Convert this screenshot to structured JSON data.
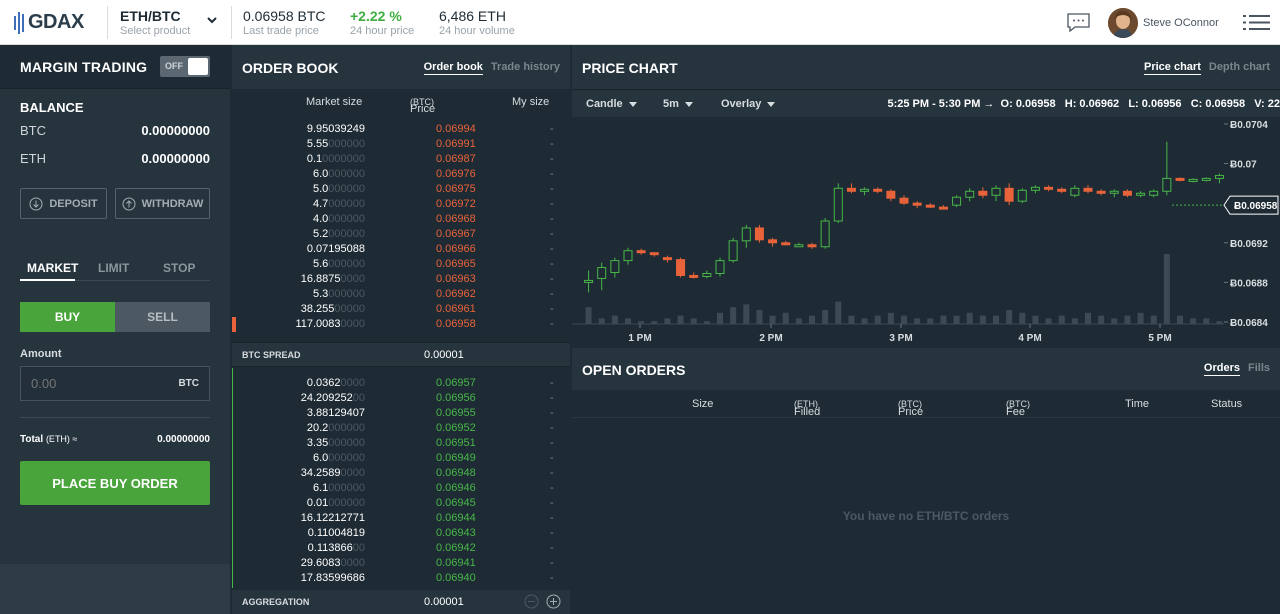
{
  "topbar": {
    "logo": "GDAX",
    "product": {
      "value": "ETH/BTC",
      "label": "Select product"
    },
    "last_trade": {
      "value": "0.06958 BTC",
      "label": "Last trade price"
    },
    "change": {
      "value": "+2.22 %",
      "label": "24 hour price"
    },
    "volume": {
      "value": "6,486 ETH",
      "label": "24 hour volume"
    },
    "user": "Steve OConnor"
  },
  "margin": {
    "title": "MARGIN TRADING",
    "toggle": "OFF"
  },
  "balance": {
    "title": "BALANCE",
    "rows": [
      {
        "currency": "BTC",
        "amount": "0.00000000"
      },
      {
        "currency": "ETH",
        "amount": "0.00000000"
      }
    ],
    "deposit": "DEPOSIT",
    "withdraw": "WITHDRAW"
  },
  "order_form": {
    "tabs": [
      "MARKET",
      "LIMIT",
      "STOP"
    ],
    "buy": "BUY",
    "sell": "SELL",
    "amount_label": "Amount",
    "amount_placeholder": "0.00",
    "amount_currency": "BTC",
    "total_label": "Total",
    "total_unit": "(ETH) ≈",
    "total_value": "0.00000000",
    "place": "PLACE BUY ORDER"
  },
  "orderbook": {
    "title": "ORDER BOOK",
    "tabs": [
      "Order book",
      "Trade history"
    ],
    "columns": {
      "size": "Market size",
      "price": "Price",
      "price_unit": "(BTC)",
      "my": "My size"
    },
    "asks": [
      {
        "size": "9.95039249",
        "pad": "",
        "price": "0.06994"
      },
      {
        "size": "5.55",
        "pad": "000000",
        "price": "0.06991"
      },
      {
        "size": "0.1",
        "pad": "0000000",
        "price": "0.06987"
      },
      {
        "size": "6.0",
        "pad": "000000",
        "price": "0.06976"
      },
      {
        "size": "5.0",
        "pad": "000000",
        "price": "0.06975"
      },
      {
        "size": "4.7",
        "pad": "000000",
        "price": "0.06972"
      },
      {
        "size": "4.0",
        "pad": "000000",
        "price": "0.06968"
      },
      {
        "size": "5.2",
        "pad": "000000",
        "price": "0.06967"
      },
      {
        "size": "0.07195088",
        "pad": "",
        "price": "0.06966"
      },
      {
        "size": "5.6",
        "pad": "000000",
        "price": "0.06965"
      },
      {
        "size": "16.8875",
        "pad": "0000",
        "price": "0.06963"
      },
      {
        "size": "5.3",
        "pad": "000000",
        "price": "0.06962"
      },
      {
        "size": "38.255",
        "pad": "00000",
        "price": "0.06961"
      },
      {
        "size": "117.0083",
        "pad": "0000",
        "price": "0.06958"
      }
    ],
    "spread_label": "BTC SPREAD",
    "spread_value": "0.00001",
    "bids": [
      {
        "size": "0.0362",
        "pad": "0000",
        "price": "0.06957"
      },
      {
        "size": "24.209252",
        "pad": "00",
        "price": "0.06956"
      },
      {
        "size": "3.88129407",
        "pad": "",
        "price": "0.06955"
      },
      {
        "size": "20.2",
        "pad": "000000",
        "price": "0.06952"
      },
      {
        "size": "3.35",
        "pad": "000000",
        "price": "0.06951"
      },
      {
        "size": "6.0",
        "pad": "000000",
        "price": "0.06949"
      },
      {
        "size": "34.2589",
        "pad": "0000",
        "price": "0.06948"
      },
      {
        "size": "6.1",
        "pad": "000000",
        "price": "0.06946"
      },
      {
        "size": "0.01",
        "pad": "000000",
        "price": "0.06945"
      },
      {
        "size": "16.12212771",
        "pad": "",
        "price": "0.06944"
      },
      {
        "size": "0.11004819",
        "pad": "",
        "price": "0.06943"
      },
      {
        "size": "0.113866",
        "pad": "00",
        "price": "0.06942"
      },
      {
        "size": "29.6083",
        "pad": "0000",
        "price": "0.06941"
      },
      {
        "size": "17.83599686",
        "pad": "",
        "price": "0.06940"
      }
    ],
    "my_placeholder": "-",
    "aggregation_label": "AGGREGATION",
    "aggregation_value": "0.00001"
  },
  "price_chart": {
    "title": "PRICE CHART",
    "tabs": [
      "Price chart",
      "Depth chart"
    ],
    "controls": {
      "type": "Candle",
      "interval": "5m",
      "overlay": "Overlay"
    },
    "ohlc": "5:25 PM - 5:30 PM →  O: 0.06958   H: 0.06962   L: 0.06956   C: 0.06958   V: 22"
  },
  "chart_data": {
    "type": "candlestick",
    "currency_symbol": "Ƀ",
    "y_ticks": [
      "0.0704",
      "0.07",
      "0.0692",
      "0.0688",
      "0.0684"
    ],
    "y_tick_values": [
      0.0704,
      0.07,
      0.0692,
      0.0688,
      0.0684
    ],
    "current_price": "0.06958",
    "ylim": [
      0.06838,
      0.07047
    ],
    "x_ticks": [
      "1 PM",
      "2 PM",
      "3 PM",
      "4 PM",
      "5 PM"
    ],
    "colors": {
      "up": "#48b748",
      "down": "#e9633a"
    },
    "candles": [
      {
        "o": 0.06882,
        "h": 0.06892,
        "l": 0.0687,
        "c": 0.06882
      },
      {
        "o": 0.06884,
        "h": 0.069,
        "l": 0.06872,
        "c": 0.06895
      },
      {
        "o": 0.0689,
        "h": 0.06905,
        "l": 0.06885,
        "c": 0.06902
      },
      {
        "o": 0.06902,
        "h": 0.06915,
        "l": 0.06898,
        "c": 0.06912
      },
      {
        "o": 0.06912,
        "h": 0.06914,
        "l": 0.06908,
        "c": 0.0691
      },
      {
        "o": 0.0691,
        "h": 0.0691,
        "l": 0.06906,
        "c": 0.06908
      },
      {
        "o": 0.06905,
        "h": 0.06907,
        "l": 0.069,
        "c": 0.06903
      },
      {
        "o": 0.06903,
        "h": 0.06905,
        "l": 0.06885,
        "c": 0.06887
      },
      {
        "o": 0.06887,
        "h": 0.0689,
        "l": 0.06884,
        "c": 0.06886
      },
      {
        "o": 0.06886,
        "h": 0.06892,
        "l": 0.06884,
        "c": 0.06889
      },
      {
        "o": 0.06889,
        "h": 0.06905,
        "l": 0.06886,
        "c": 0.06902
      },
      {
        "o": 0.06902,
        "h": 0.06925,
        "l": 0.069,
        "c": 0.06922
      },
      {
        "o": 0.06922,
        "h": 0.06938,
        "l": 0.06915,
        "c": 0.06935
      },
      {
        "o": 0.06935,
        "h": 0.06938,
        "l": 0.0692,
        "c": 0.06923
      },
      {
        "o": 0.06923,
        "h": 0.06925,
        "l": 0.06916,
        "c": 0.0692
      },
      {
        "o": 0.0692,
        "h": 0.06922,
        "l": 0.06918,
        "c": 0.06918
      },
      {
        "o": 0.06918,
        "h": 0.0692,
        "l": 0.06916,
        "c": 0.06918
      },
      {
        "o": 0.06918,
        "h": 0.0692,
        "l": 0.06914,
        "c": 0.06916
      },
      {
        "o": 0.06916,
        "h": 0.06945,
        "l": 0.06914,
        "c": 0.06942
      },
      {
        "o": 0.06942,
        "h": 0.0698,
        "l": 0.0694,
        "c": 0.06975
      },
      {
        "o": 0.06975,
        "h": 0.0698,
        "l": 0.0697,
        "c": 0.06972
      },
      {
        "o": 0.06972,
        "h": 0.06976,
        "l": 0.06968,
        "c": 0.06974
      },
      {
        "o": 0.06974,
        "h": 0.06976,
        "l": 0.0697,
        "c": 0.06972
      },
      {
        "o": 0.06972,
        "h": 0.06974,
        "l": 0.06962,
        "c": 0.06965
      },
      {
        "o": 0.06965,
        "h": 0.06968,
        "l": 0.06958,
        "c": 0.0696
      },
      {
        "o": 0.0696,
        "h": 0.06962,
        "l": 0.06955,
        "c": 0.06958
      },
      {
        "o": 0.06958,
        "h": 0.0696,
        "l": 0.06955,
        "c": 0.06956
      },
      {
        "o": 0.06956,
        "h": 0.06958,
        "l": 0.06954,
        "c": 0.06955
      },
      {
        "o": 0.06958,
        "h": 0.06968,
        "l": 0.06956,
        "c": 0.06966
      },
      {
        "o": 0.06966,
        "h": 0.06975,
        "l": 0.06962,
        "c": 0.06972
      },
      {
        "o": 0.06972,
        "h": 0.06976,
        "l": 0.06965,
        "c": 0.06968
      },
      {
        "o": 0.06968,
        "h": 0.06978,
        "l": 0.06962,
        "c": 0.06975
      },
      {
        "o": 0.06975,
        "h": 0.0698,
        "l": 0.06958,
        "c": 0.06962
      },
      {
        "o": 0.06962,
        "h": 0.06975,
        "l": 0.0696,
        "c": 0.06973
      },
      {
        "o": 0.06973,
        "h": 0.06978,
        "l": 0.0697,
        "c": 0.06976
      },
      {
        "o": 0.06976,
        "h": 0.06978,
        "l": 0.06972,
        "c": 0.06974
      },
      {
        "o": 0.06974,
        "h": 0.06976,
        "l": 0.0697,
        "c": 0.06972
      },
      {
        "o": 0.06968,
        "h": 0.06978,
        "l": 0.06966,
        "c": 0.06975
      },
      {
        "o": 0.06975,
        "h": 0.06978,
        "l": 0.0697,
        "c": 0.06972
      },
      {
        "o": 0.06972,
        "h": 0.06974,
        "l": 0.06968,
        "c": 0.0697
      },
      {
        "o": 0.0697,
        "h": 0.06974,
        "l": 0.06966,
        "c": 0.06972
      },
      {
        "o": 0.06972,
        "h": 0.06974,
        "l": 0.06966,
        "c": 0.06968
      },
      {
        "o": 0.06968,
        "h": 0.06972,
        "l": 0.06966,
        "c": 0.0697
      },
      {
        "o": 0.06968,
        "h": 0.06974,
        "l": 0.06966,
        "c": 0.06972
      },
      {
        "o": 0.06972,
        "h": 0.07022,
        "l": 0.06968,
        "c": 0.06985
      },
      {
        "o": 0.06985,
        "h": 0.06986,
        "l": 0.06982,
        "c": 0.06983
      },
      {
        "o": 0.06983,
        "h": 0.06985,
        "l": 0.06981,
        "c": 0.06984
      },
      {
        "o": 0.06984,
        "h": 0.06986,
        "l": 0.06982,
        "c": 0.06985
      },
      {
        "o": 0.06985,
        "h": 0.0699,
        "l": 0.0698,
        "c": 0.06988
      }
    ],
    "volumes": [
      6,
      2,
      3,
      2,
      1,
      1,
      2,
      3,
      2,
      1,
      4,
      6,
      7,
      5,
      3,
      4,
      2,
      3,
      5,
      8,
      3,
      2,
      3,
      4,
      3,
      2,
      2,
      3,
      3,
      4,
      3,
      3,
      5,
      4,
      3,
      2,
      3,
      2,
      4,
      3,
      2,
      3,
      4,
      3,
      25,
      3,
      2,
      2,
      1
    ]
  },
  "open_orders": {
    "title": "OPEN ORDERS",
    "tabs": [
      "Orders",
      "Fills"
    ],
    "columns": {
      "size": "Size",
      "filled": "Filled",
      "filled_unit": "(ETH)",
      "price": "Price",
      "price_unit": "(BTC)",
      "fee": "Fee",
      "fee_unit": "(BTC)",
      "time": "Time",
      "status": "Status"
    },
    "empty": "You have no ETH/BTC orders"
  }
}
